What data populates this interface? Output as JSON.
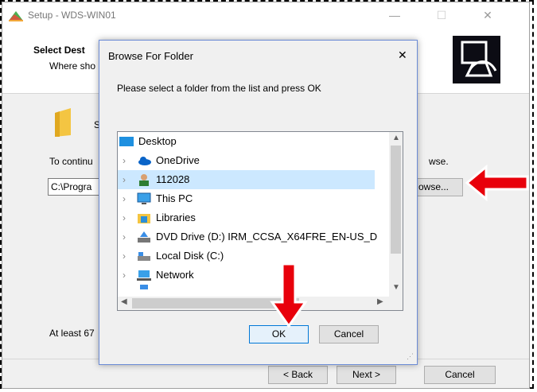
{
  "setup": {
    "title": "Setup - WDS-WIN01",
    "minimize_glyph": "—",
    "maximize_glyph": "☐",
    "close_glyph": "✕",
    "header_title": "Select Dest",
    "header_subtitle": "Where sho",
    "folder_text": "S",
    "continue_text": "To continu",
    "browse_tail": "wse.",
    "path_value": "C:\\Progra",
    "browse_button": "owse...",
    "space_text": "At least 67",
    "back_button": "< Back",
    "next_button": "Next >",
    "cancel_button": "Cancel"
  },
  "dialog": {
    "title": "Browse For Folder",
    "close_glyph": "✕",
    "instruction": "Please select a folder from the list and press OK",
    "tree": [
      {
        "label": "Desktop",
        "icon": "desktop-icon"
      },
      {
        "label": "OneDrive",
        "icon": "onedrive-icon"
      },
      {
        "label": "112028",
        "icon": "user-icon"
      },
      {
        "label": "This PC",
        "icon": "computer-icon"
      },
      {
        "label": "Libraries",
        "icon": "libraries-icon"
      },
      {
        "label": "DVD Drive (D:) IRM_CCSA_X64FRE_EN-US_D",
        "icon": "dvd-icon"
      },
      {
        "label": "Local Disk (C:)",
        "icon": "disk-icon"
      },
      {
        "label": "Network",
        "icon": "network-icon"
      }
    ],
    "ok_button": "OK",
    "cancel_button": "Cancel"
  },
  "colors": {
    "arrow": "#e8000b",
    "selection": "#cce8ff",
    "dialog_border": "#6b8bd6",
    "ok_border": "#0078d7"
  }
}
